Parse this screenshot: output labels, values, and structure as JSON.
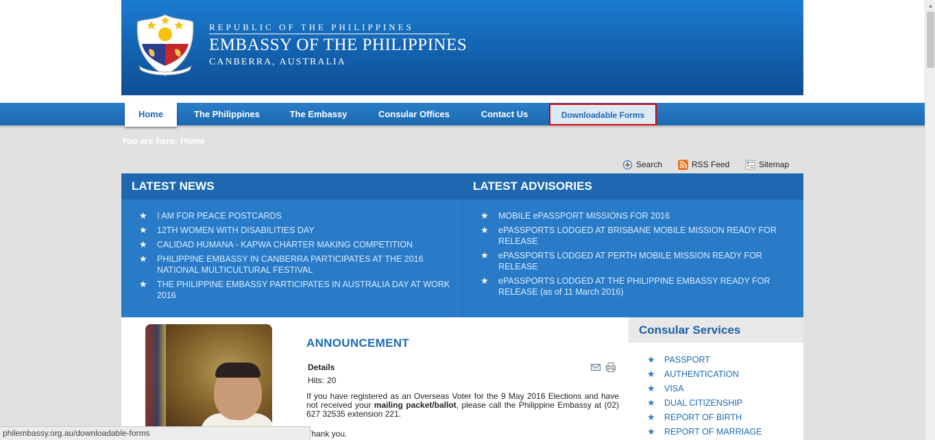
{
  "banner": {
    "republic": "REPUBLIC OF THE PHILIPPINES",
    "embassy": "EMBASSY OF THE PHILIPPINES",
    "location": "CANBERRA, AUSTRALIA"
  },
  "nav": {
    "items": [
      "Home",
      "The Philippines",
      "The Embassy",
      "Consular Offices",
      "Contact Us",
      "Downloadable Forms"
    ]
  },
  "breadcrumb": {
    "prefix": "You are here:",
    "current": "Home"
  },
  "tools": {
    "search": "Search",
    "rss": "RSS Feed",
    "sitemap": "Sitemap"
  },
  "latest_news": {
    "title": "LATEST NEWS",
    "items": [
      "I AM FOR PEACE POSTCARDS",
      "12TH WOMEN WITH DISABILITIES DAY",
      "CALIDAD HUMANA - KAPWA CHARTER MAKING COMPETITION",
      "PHILIPPINE EMBASSY IN CANBERRA PARTICIPATES AT THE 2016 NATIONAL MULTICULTURAL FESTIVAL",
      "THE PHILIPPINE EMBASSY PARTICIPATES IN AUSTRALIA DAY AT WORK 2016"
    ]
  },
  "latest_advisories": {
    "title": "LATEST ADVISORIES",
    "items": [
      "MOBILE ePASSPORT MISSIONS FOR 2016",
      "ePASSPORTS LODGED AT BRISBANE MOBILE MISSION READY FOR RELEASE",
      "ePASSPORTS LODGED AT PERTH MOBILE MISSION READY FOR RELEASE",
      "ePASSPORTS LODGED AT THE PHILIPPINE EMBASSY READY FOR RELEASE (as of 11 March 2016)"
    ]
  },
  "announcement": {
    "title": "ANNOUNCEMENT",
    "details_label": "Details",
    "hits_label": "Hits:",
    "hits_value": "20",
    "body_before": "If you have registered as an Overseas Voter for the 9 May 2016 Elections and have not received your ",
    "body_bold": "mailing packet/ballot",
    "body_after": ", please call the Philippine Embassy at (02) 627 32535 extension 221.",
    "thanks": "Thank you."
  },
  "consular": {
    "title": "Consular Services",
    "items": [
      "PASSPORT",
      "AUTHENTICATION",
      "VISA",
      "DUAL CITIZENSHIP",
      "REPORT OF BIRTH",
      "REPORT OF MARRIAGE"
    ]
  },
  "status_url": "philembassy.org.au/downloadable-forms",
  "colors": {
    "banner_blue": "#1466b4",
    "nav_blue": "#1a68b0",
    "news_bg": "#2a7bc7",
    "link_blue": "#1a6cb8",
    "highlight_red": "#e00000"
  },
  "icons": [
    "seal-emblem-icon",
    "search-icon",
    "rss-icon",
    "sitemap-icon",
    "star-icon",
    "email-icon",
    "print-icon"
  ]
}
